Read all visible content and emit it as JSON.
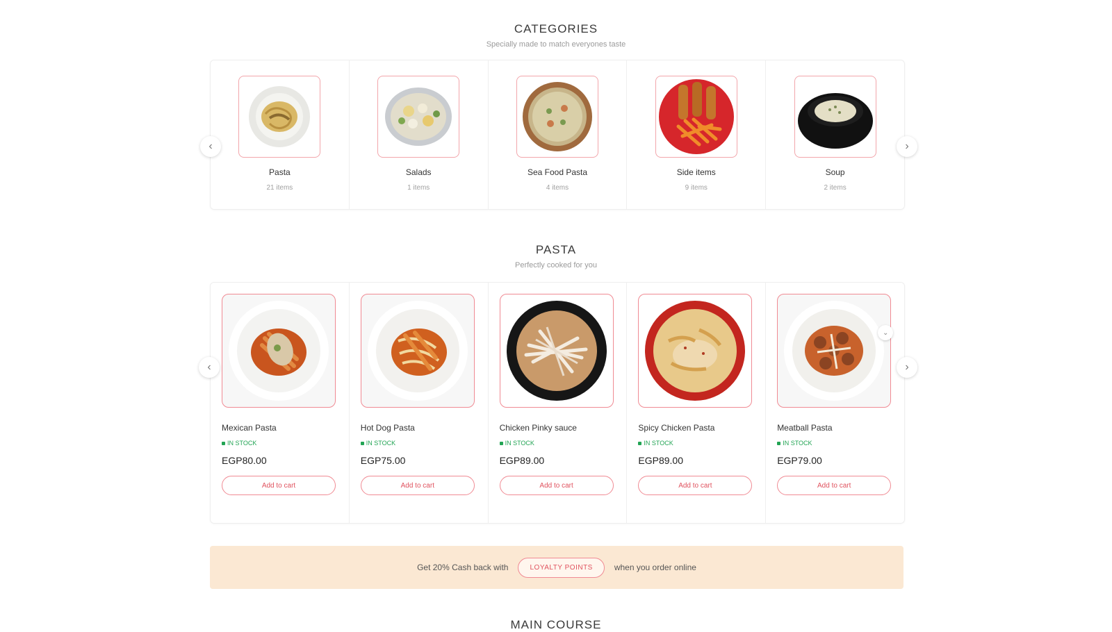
{
  "categories": {
    "title": "CATEGORIES",
    "subtitle": "Specially made to match everyones taste",
    "items": [
      {
        "name": "Pasta",
        "count": "21 items",
        "icon": "pasta-plate"
      },
      {
        "name": "Salads",
        "count": "1 items",
        "icon": "salad-plate"
      },
      {
        "name": "Sea Food Pasta",
        "count": "4 items",
        "icon": "seafood-plate"
      },
      {
        "name": "Side items",
        "count": "9 items",
        "icon": "fries-plate"
      },
      {
        "name": "Soup",
        "count": "2 items",
        "icon": "soup-bowl"
      }
    ]
  },
  "pasta": {
    "title": "PASTA",
    "subtitle": "Perfectly cooked for you",
    "products": [
      {
        "name": "Mexican Pasta",
        "stock": "IN STOCK",
        "price": "EGP80.00",
        "button": "Add to cart"
      },
      {
        "name": "Hot Dog Pasta",
        "stock": "IN STOCK",
        "price": "EGP75.00",
        "button": "Add to cart"
      },
      {
        "name": "Chicken Pinky sauce",
        "stock": "IN STOCK",
        "price": "EGP89.00",
        "button": "Add to cart"
      },
      {
        "name": "Spicy Chicken Pasta",
        "stock": "IN STOCK",
        "price": "EGP89.00",
        "button": "Add to cart"
      },
      {
        "name": "Meatball Pasta",
        "stock": "IN STOCK",
        "price": "EGP79.00",
        "button": "Add to cart"
      }
    ]
  },
  "banner": {
    "text_before": "Get 20% Cash back with",
    "button": "LOYALTY POINTS",
    "text_after": "when you order online"
  },
  "next_section": {
    "title": "MAIN COURSE"
  },
  "colors": {
    "accent": "#e0525e",
    "accent_border": "#f08a93",
    "stock": "#22a454",
    "banner_bg": "#fbe8d3"
  }
}
